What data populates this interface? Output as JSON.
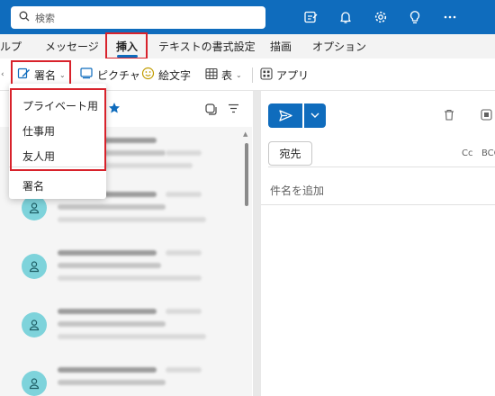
{
  "search": {
    "placeholder": "検索"
  },
  "tabs": [
    {
      "label": "ルプ"
    },
    {
      "label": "メッセージ"
    },
    {
      "label": "挿入"
    },
    {
      "label": "テキストの書式設定"
    },
    {
      "label": "描画"
    },
    {
      "label": "オプション"
    }
  ],
  "toolbar": {
    "signature": "署名",
    "picture": "ピクチャ",
    "emoji": "絵文字",
    "table": "表",
    "apps": "アプリ"
  },
  "signature_menu": {
    "items": [
      {
        "label": "プライベート用"
      },
      {
        "label": "仕事用"
      },
      {
        "label": "友人用"
      }
    ],
    "footer": "署名"
  },
  "compose": {
    "to_label": "宛先",
    "cc_label": "Cc",
    "bcc_label": "BCC",
    "subject_placeholder": "件名を追加"
  },
  "colors": {
    "brand": "#0f6cbd",
    "highlight": "#d8222b",
    "avatar": "#7ed3db"
  }
}
